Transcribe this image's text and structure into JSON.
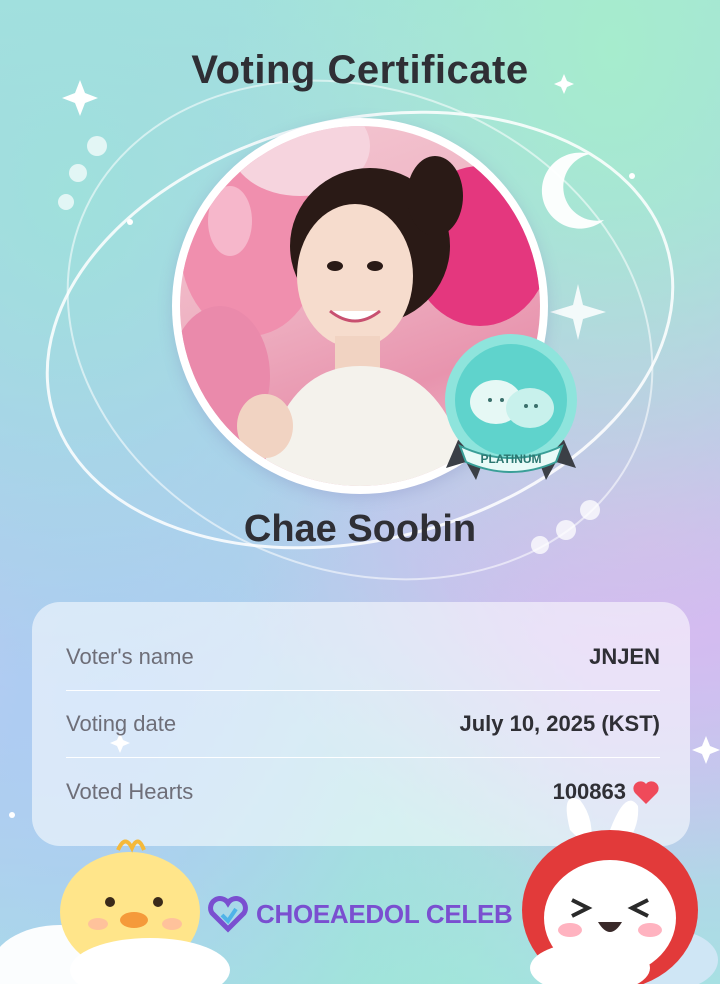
{
  "certificate": {
    "title": "Voting Certificate",
    "idol_name": "Chae Soobin",
    "badge_label": "PLATINUM"
  },
  "details": {
    "rows": [
      {
        "label": "Voter's name",
        "value": "JNJEN"
      },
      {
        "label": "Voting date",
        "value": "July 10, 2025 (KST)"
      },
      {
        "label": "Voted Hearts",
        "value": "100863"
      }
    ]
  },
  "brand": {
    "name": "CHOEAEDOL CELEB"
  },
  "colors": {
    "heart": "#ef4a5a",
    "brand": "#7a4fd0",
    "badge": "#6fd6d0",
    "text": "#2f2f35"
  },
  "icons": [
    "sparkle-icon",
    "crescent-moon-icon",
    "heart-icon",
    "platinum-badge-icon",
    "brand-logo-icon"
  ]
}
